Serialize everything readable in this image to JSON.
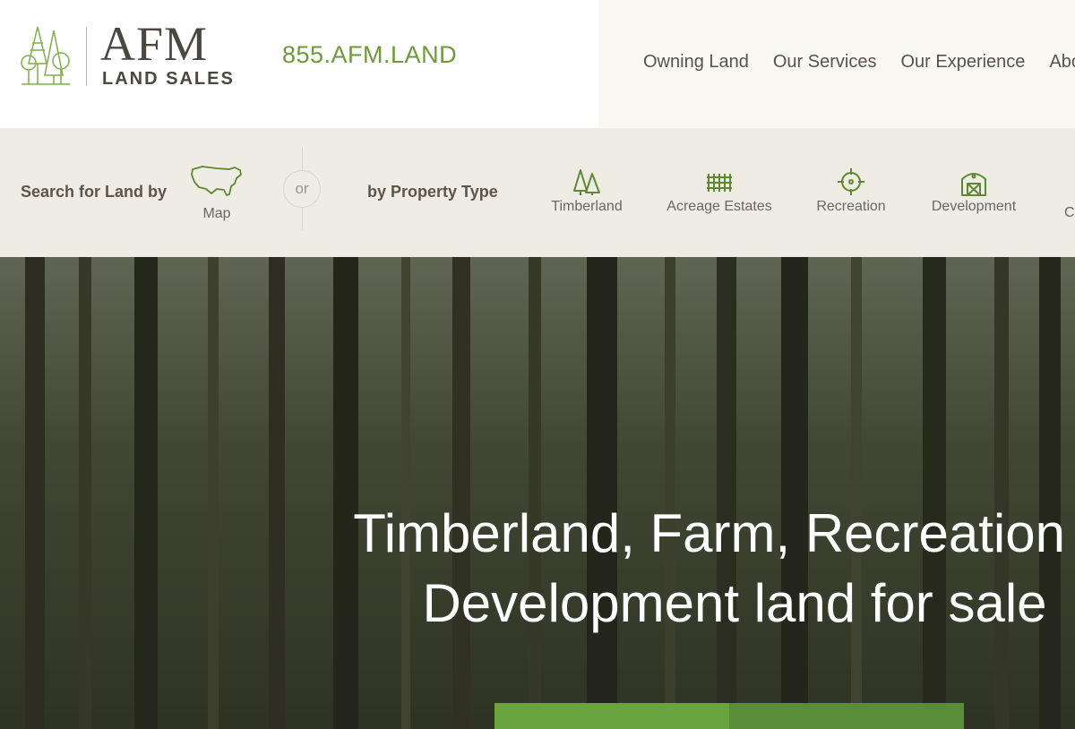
{
  "header": {
    "logo": {
      "title": "AFM",
      "subtitle": "LAND SALES"
    },
    "phone": "855.AFM.LAND",
    "nav": [
      "Owning Land",
      "Our Services",
      "Our Experience",
      "Abou"
    ]
  },
  "search": {
    "label": "Search for Land by",
    "map_label": "Map",
    "or_label": "or",
    "by_type_label": "by Property Type",
    "types": [
      {
        "label": "Timberland",
        "icon": "trees-icon"
      },
      {
        "label": "Acreage Estates",
        "icon": "fence-icon"
      },
      {
        "label": "Recreation",
        "icon": "crosshair-icon"
      },
      {
        "label": "Development",
        "icon": "barn-icon"
      }
    ],
    "cut_type_label": "C"
  },
  "hero": {
    "line1": "Timberland, Farm, Recreation &",
    "line2": "Development land for sale"
  },
  "colors": {
    "brand_green": "#6e9a3a",
    "text_brown": "#5a5248",
    "cta_green": "#6aa43f",
    "cta_green_dark": "#5a8d38"
  }
}
